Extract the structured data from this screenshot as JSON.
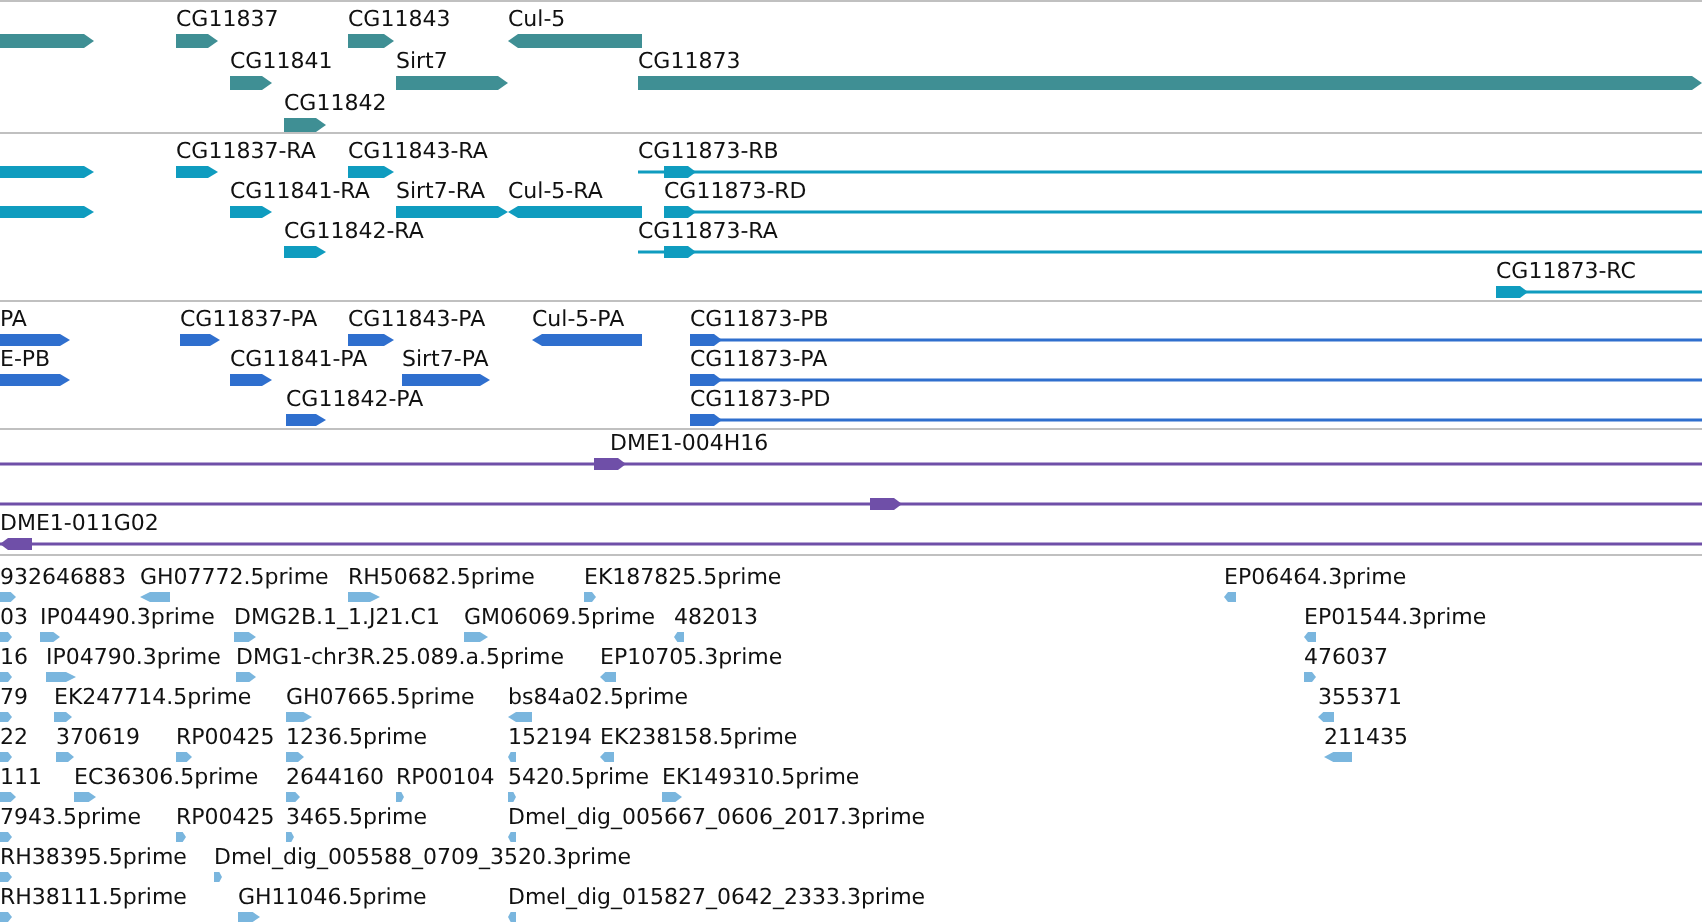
{
  "tracks": [
    {
      "kind": "gene",
      "color": "#3f8f94",
      "features": [
        {
          "reverse": false
        },
        {
          "label": "CG11837",
          "reverse": false
        },
        {
          "label": "CG11843",
          "reverse": false
        },
        {
          "label": "Cul-5",
          "reverse": true
        },
        {
          "label": "CG11841",
          "reverse": false
        },
        {
          "label": "Sirt7",
          "reverse": false
        },
        {
          "label": "CG11873",
          "reverse": false
        },
        {
          "label": "CG11842",
          "reverse": false
        }
      ]
    },
    {
      "kind": "transcript",
      "color": "#0f9cbf",
      "features": [
        {
          "reverse": false
        },
        {
          "label": "CG11837-RA",
          "reverse": false
        },
        {
          "label": "CG11843-RA",
          "reverse": false
        },
        {
          "label": "CG11873-RB",
          "reverse": false
        },
        {
          "reverse": false
        },
        {
          "label": "CG11841-RA",
          "reverse": false
        },
        {
          "label": "Sirt7-RA",
          "reverse": false
        },
        {
          "label": "Cul-5-RA",
          "reverse": true
        },
        {
          "label": "CG11873-RD",
          "reverse": false
        },
        {
          "label": "CG11842-RA",
          "reverse": false
        },
        {
          "label": "CG11873-RA",
          "reverse": false
        },
        {
          "label": "CG11873-RC",
          "reverse": false
        }
      ]
    },
    {
      "kind": "protein",
      "color": "#2f6fce",
      "features": [
        {
          "label": "PA",
          "reverse": false
        },
        {
          "label": "CG11837-PA",
          "reverse": false
        },
        {
          "label": "CG11843-PA",
          "reverse": false
        },
        {
          "label": "Cul-5-PA",
          "reverse": true
        },
        {
          "label": "CG11873-PB",
          "reverse": false
        },
        {
          "label": "E-PB",
          "reverse": false
        },
        {
          "label": "CG11841-PA",
          "reverse": false
        },
        {
          "label": "Sirt7-PA",
          "reverse": false
        },
        {
          "label": "CG11873-PA",
          "reverse": false
        },
        {
          "label": "CG11842-PA",
          "reverse": false
        },
        {
          "label": "CG11873-PD",
          "reverse": false
        }
      ]
    },
    {
      "kind": "clone",
      "color": "#6f4fa8",
      "features": [
        {
          "label": "DME1-004H16",
          "reverse": false
        },
        {
          "reverse": false
        },
        {
          "label": "DME1-011G02",
          "reverse": true
        }
      ]
    },
    {
      "kind": "est",
      "color": "#7ab6de",
      "features": [
        {
          "label": "932646883",
          "reverse": false
        },
        {
          "label": "GH07772.5prime",
          "reverse": true
        },
        {
          "label": "RH50682.5prime",
          "reverse": false
        },
        {
          "label": "EK187825.5prime",
          "reverse": false
        },
        {
          "label": "EP06464.3prime",
          "reverse": true
        },
        {
          "label": "03",
          "reverse": false
        },
        {
          "label": "IP04490.3prime",
          "reverse": false
        },
        {
          "label": "DMG2B.1_1.J21.C1",
          "reverse": false
        },
        {
          "label": "GM06069.5prime",
          "reverse": false
        },
        {
          "label": "482013",
          "reverse": true
        },
        {
          "label": "EP01544.3prime",
          "reverse": true
        },
        {
          "label": "16",
          "reverse": false
        },
        {
          "label": "IP04790.3prime",
          "reverse": false
        },
        {
          "label": "DMG1-chr3R.25.089.a.5prime",
          "reverse": false
        },
        {
          "label": "EP10705.3prime",
          "reverse": true
        },
        {
          "label": "476037",
          "reverse": false
        },
        {
          "label": "79",
          "reverse": false
        },
        {
          "label": "EK247714.5prime",
          "reverse": false
        },
        {
          "label": "GH07665.5prime",
          "reverse": false
        },
        {
          "label": "bs84a02.5prime",
          "reverse": true
        },
        {
          "label": "355371",
          "reverse": true
        },
        {
          "label": "22",
          "reverse": false
        },
        {
          "label": "370619",
          "reverse": false
        },
        {
          "label": "RP00425",
          "reverse": false
        },
        {
          "label": "1236.5prime",
          "reverse": false
        },
        {
          "label": "152194",
          "reverse": true
        },
        {
          "label": "EK238158.5prime",
          "reverse": true
        },
        {
          "label": "211435",
          "reverse": true
        },
        {
          "label": "111",
          "reverse": false
        },
        {
          "label": "EC36306.5prime",
          "reverse": false
        },
        {
          "label": "2644160",
          "reverse": false
        },
        {
          "label": "RP00104",
          "reverse": false
        },
        {
          "label": "5420.5prime",
          "reverse": false
        },
        {
          "label": "EK149310.5prime",
          "reverse": false
        },
        {
          "label": "7943.5prime",
          "reverse": false
        },
        {
          "label": "RP00425",
          "reverse": false
        },
        {
          "label": "3465.5prime",
          "reverse": false
        },
        {
          "label": "Dmel_dig_005667_0606_2017.3prime",
          "reverse": true
        },
        {
          "label": "RH38395.5prime",
          "reverse": false
        },
        {
          "label": "Dmel_dig_005588_0709_3520.3prime",
          "reverse": false
        },
        {
          "label": "RH38111.5prime",
          "reverse": false
        },
        {
          "label": "GH11046.5prime",
          "reverse": false
        },
        {
          "label": "Dmel_dig_015827_0642_2333.3prime",
          "reverse": true
        }
      ]
    }
  ]
}
